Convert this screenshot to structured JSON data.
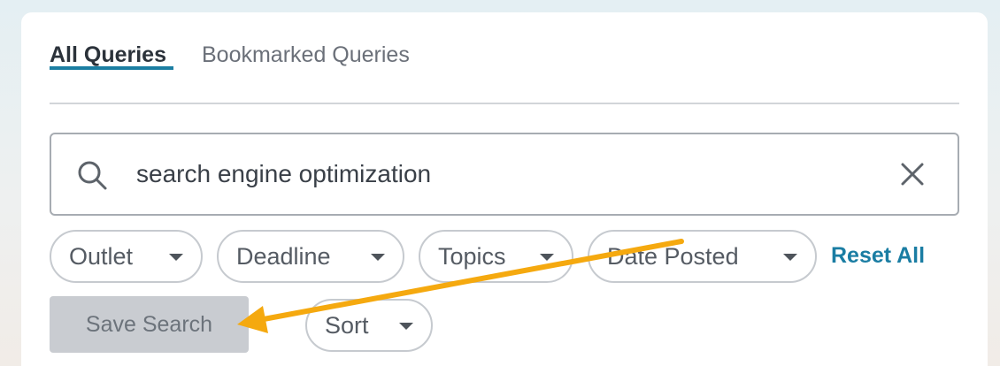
{
  "tabs": {
    "all_queries": "All Queries",
    "bookmarked_queries": "Bookmarked Queries"
  },
  "search": {
    "value": "search engine optimization",
    "icon": "search-icon",
    "clear_icon": "close-icon"
  },
  "filters": {
    "outlet": "Outlet",
    "deadline": "Deadline",
    "topics": "Topics",
    "date_posted": "Date Posted",
    "reset_all": "Reset All"
  },
  "actions": {
    "save_search": "Save Search",
    "sort": "Sort"
  },
  "colors": {
    "accent": "#1b7ea2",
    "annotation_arrow": "#f5a90f",
    "disabled_button": "#c9ccd1"
  }
}
